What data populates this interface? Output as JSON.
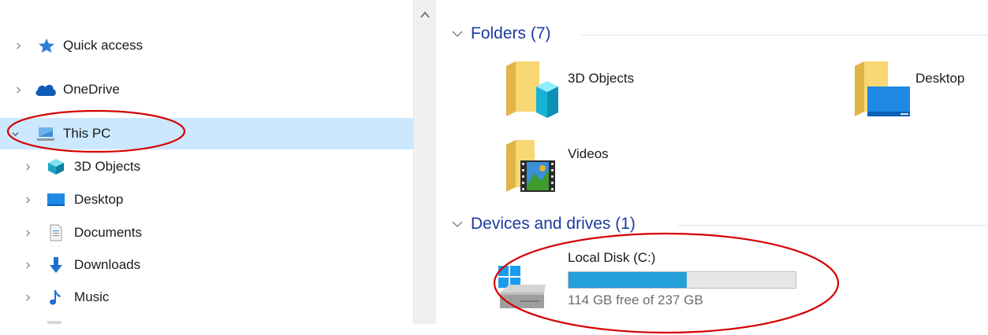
{
  "nav": {
    "items": [
      {
        "label": "Quick access",
        "icon": "star-icon",
        "expanded": false
      },
      {
        "label": "OneDrive",
        "icon": "cloud-icon",
        "expanded": false
      },
      {
        "label": "This PC",
        "icon": "computer-icon",
        "expanded": true,
        "selected": true
      },
      {
        "label": "3D Objects",
        "icon": "cube-icon",
        "expanded": false
      },
      {
        "label": "Desktop",
        "icon": "desktop-icon",
        "expanded": false
      },
      {
        "label": "Documents",
        "icon": "document-icon",
        "expanded": false
      },
      {
        "label": "Downloads",
        "icon": "download-arrow-icon",
        "expanded": false
      },
      {
        "label": "Music",
        "icon": "music-note-icon",
        "expanded": false
      }
    ]
  },
  "content": {
    "folders_header": "Folders (7)",
    "folders": [
      {
        "label": "3D Objects",
        "icon": "3d-objects-folder-icon"
      },
      {
        "label": "Desktop",
        "icon": "desktop-folder-icon"
      },
      {
        "label": "Videos",
        "icon": "videos-folder-icon"
      }
    ],
    "devices_header": "Devices and drives (1)",
    "drive": {
      "label": "Local Disk (C:)",
      "free_text": "114 GB free of 237 GB",
      "used_fraction": 0.52,
      "icon": "hard-drive-icon"
    }
  },
  "colors": {
    "selected_bg": "#cce8ff",
    "header_text": "#1c3a9e",
    "bar_fill": "#26a0da",
    "annotation": "#d40000"
  }
}
